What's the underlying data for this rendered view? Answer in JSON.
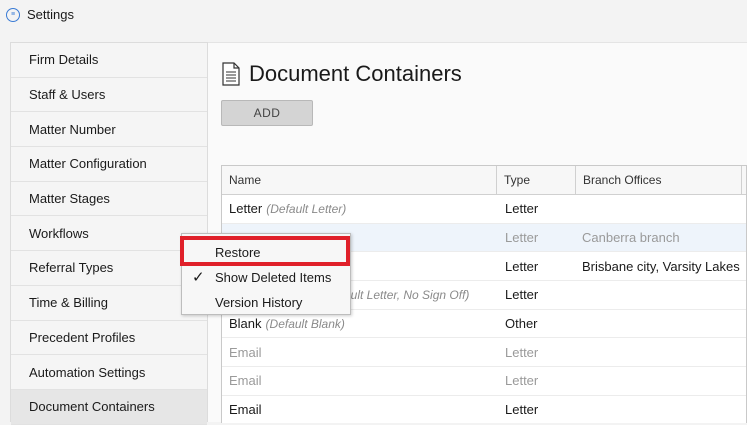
{
  "window": {
    "title": "Settings"
  },
  "sidebar": {
    "items": [
      {
        "label": "Firm Details"
      },
      {
        "label": "Staff & Users"
      },
      {
        "label": "Matter Number"
      },
      {
        "label": "Matter Configuration"
      },
      {
        "label": "Matter Stages"
      },
      {
        "label": "Workflows"
      },
      {
        "label": "Referral Types"
      },
      {
        "label": "Time & Billing"
      },
      {
        "label": "Precedent Profiles"
      },
      {
        "label": "Automation Settings"
      },
      {
        "label": "Document Containers"
      }
    ],
    "active": "Document Containers"
  },
  "main": {
    "title": "Document Containers",
    "add_label": "ADD",
    "columns": {
      "name": "Name",
      "type": "Type",
      "branch": "Branch Offices"
    },
    "rows": [
      {
        "name": "Letter",
        "note": "(Default Letter)",
        "type": "Letter",
        "branch": "",
        "deleted": false
      },
      {
        "name": "",
        "note": "",
        "type": "Letter",
        "branch": "Canberra branch",
        "deleted": true
      },
      {
        "name": "",
        "note": "",
        "type": "Letter",
        "branch": "Brisbane city, Varsity Lakes",
        "deleted": false
      },
      {
        "name": "",
        "note": "ault Letter, No Sign Off)",
        "type": "Letter",
        "branch": "",
        "deleted": false
      },
      {
        "name": "Blank",
        "note": "(Default Blank)",
        "type": "Other",
        "branch": "",
        "deleted": false
      },
      {
        "name": "Email",
        "note": "",
        "type": "Letter",
        "branch": "",
        "deleted": true
      },
      {
        "name": "Email",
        "note": "",
        "type": "Letter",
        "branch": "",
        "deleted": true
      },
      {
        "name": "Email",
        "note": "",
        "type": "Letter",
        "branch": "",
        "deleted": false
      }
    ]
  },
  "context_menu": {
    "items": [
      {
        "label": "Restore",
        "checked": false
      },
      {
        "label": "Show Deleted Items",
        "checked": true
      },
      {
        "label": "Version History",
        "checked": false
      }
    ]
  },
  "colors": {
    "highlight": "#e0202a",
    "accent": "#3a7bd5"
  },
  "icons": {
    "app": "app-logo-icon",
    "page": "document-icon",
    "check": "checkmark-icon"
  }
}
